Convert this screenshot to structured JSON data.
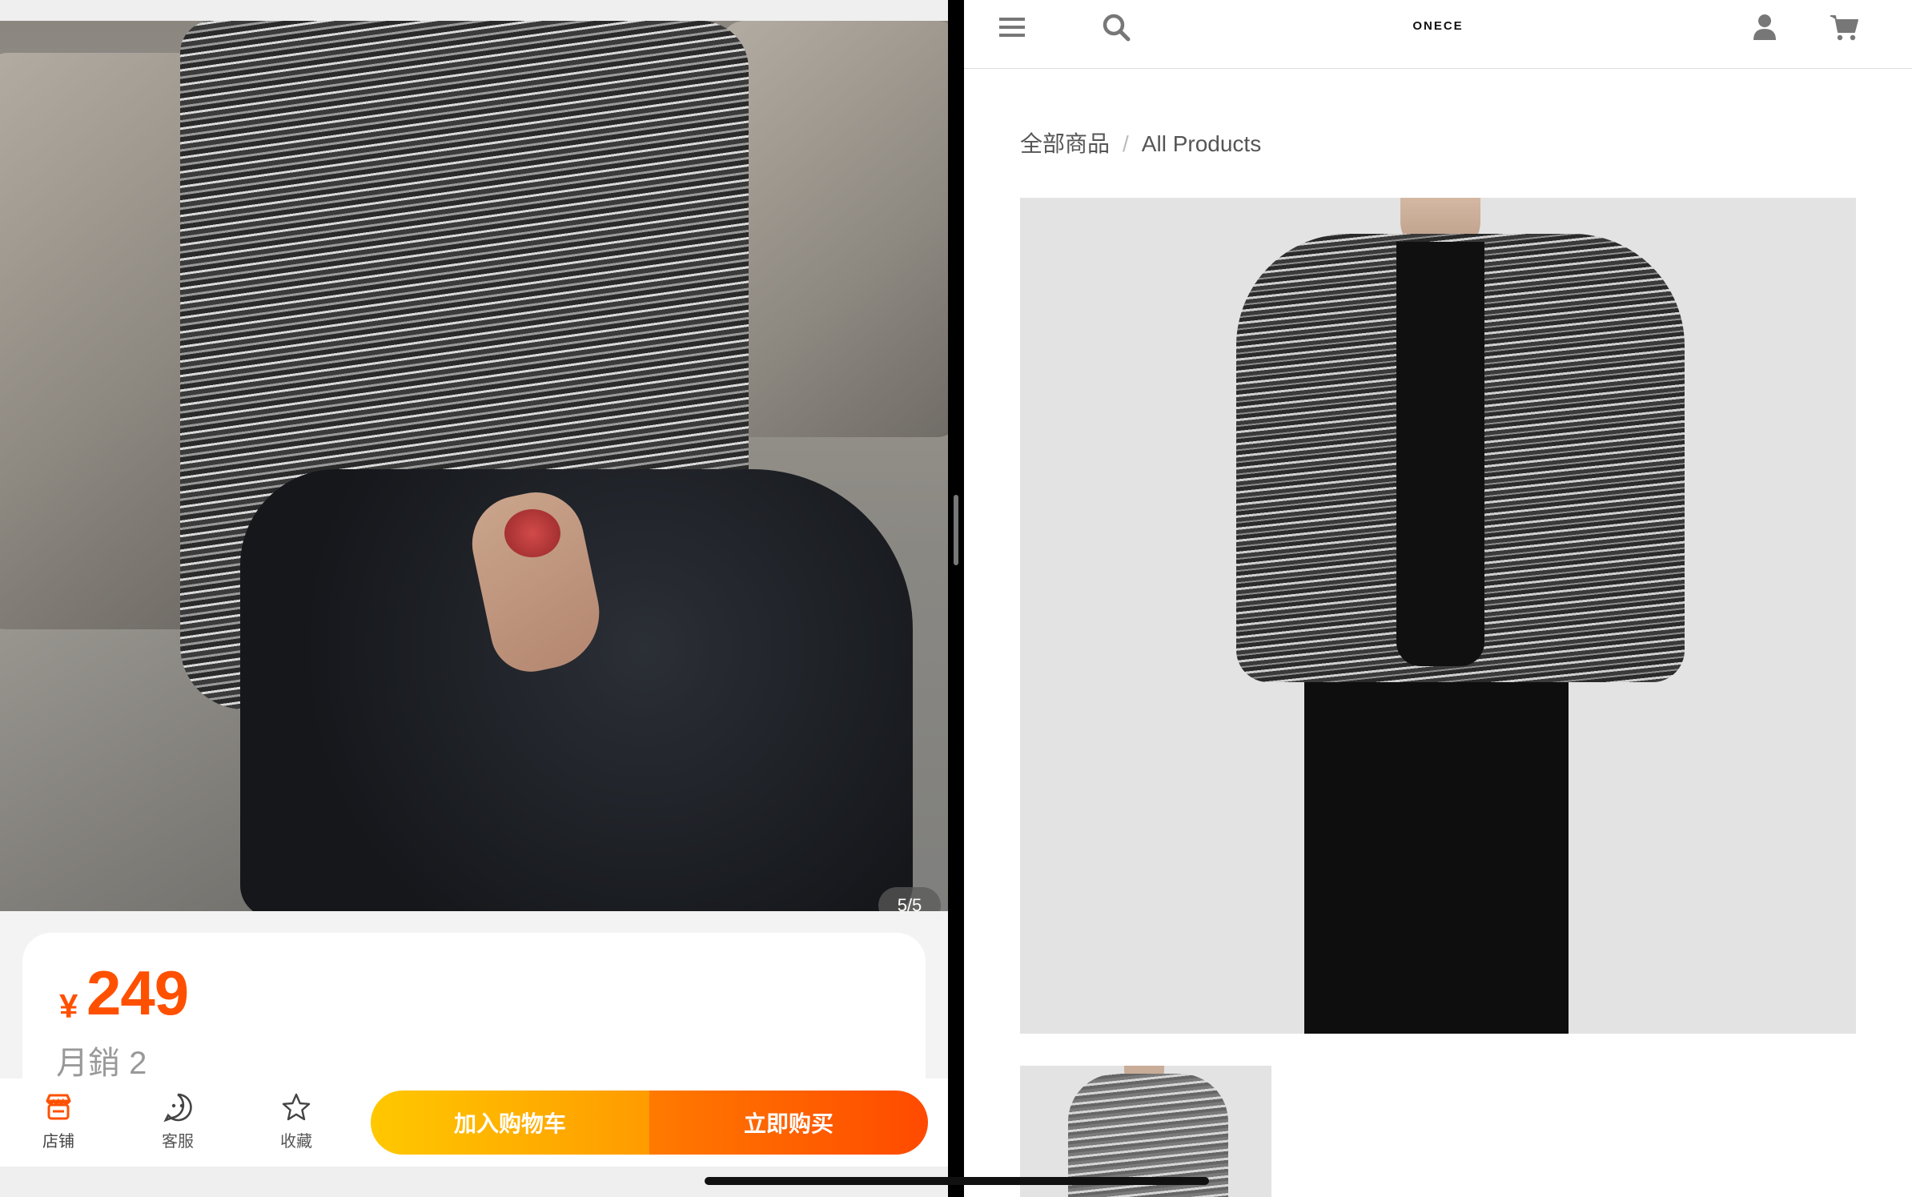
{
  "left_app": {
    "page_indicator": "5/5",
    "price": {
      "currency_symbol": "¥",
      "amount": "249"
    },
    "monthly_sales": "月銷 2",
    "bottom_bar": {
      "store_label": "店铺",
      "service_label": "客服",
      "favorite_label": "收藏",
      "add_to_cart_label": "加入购物车",
      "buy_now_label": "立即购买"
    },
    "accent_color": "#ff5000"
  },
  "right_site": {
    "brand": "ONECE",
    "breadcrumb": {
      "parent": "全部商品",
      "separator": "/",
      "current": "All Products"
    },
    "header_icons": [
      "menu-icon",
      "search-icon",
      "user-icon",
      "cart-icon"
    ]
  }
}
